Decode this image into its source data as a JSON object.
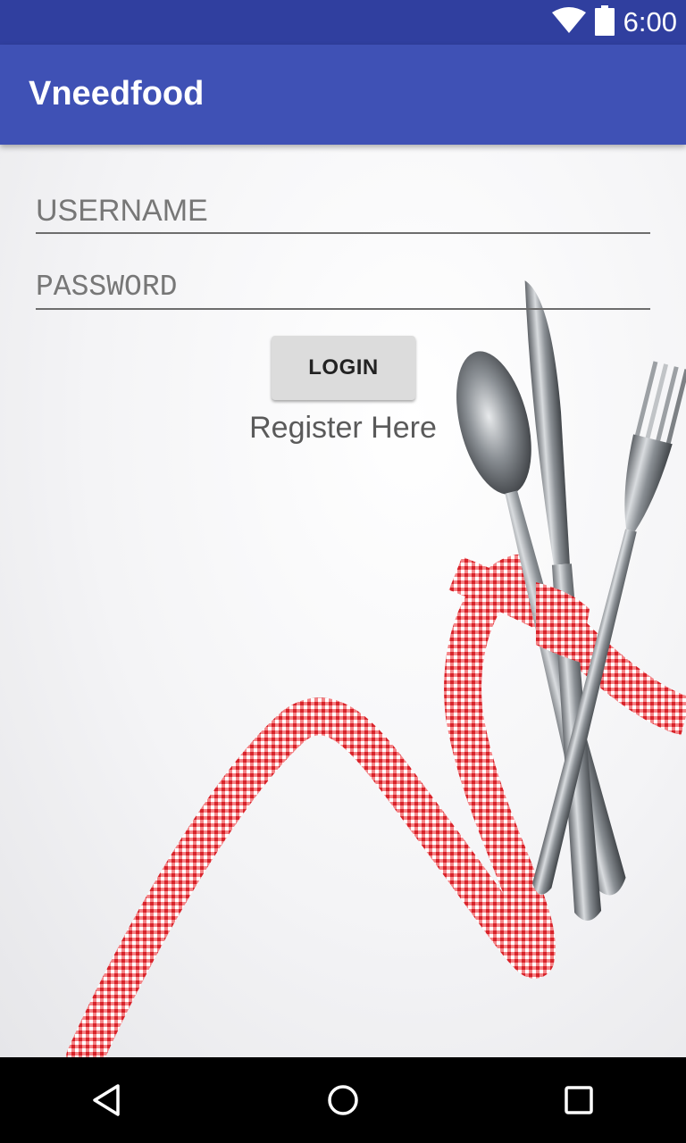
{
  "status_bar": {
    "time": "6:00",
    "icons": [
      "wifi-icon",
      "battery-icon"
    ],
    "background": "#303f9f"
  },
  "app_bar": {
    "title": "Vneedfood",
    "background": "#3f51b5"
  },
  "login_form": {
    "username_placeholder": "USERNAME",
    "username_value": "",
    "password_placeholder": "PASSWORD",
    "password_value": "",
    "login_label": "LOGIN",
    "register_label": "Register Here"
  },
  "background_image": {
    "subject": "spoon, knife and fork tied with red gingham ribbon on white surface",
    "ribbon_color": "#e8353a"
  },
  "nav_bar": {
    "icons": [
      "back-icon",
      "home-icon",
      "recent-apps-icon"
    ]
  }
}
